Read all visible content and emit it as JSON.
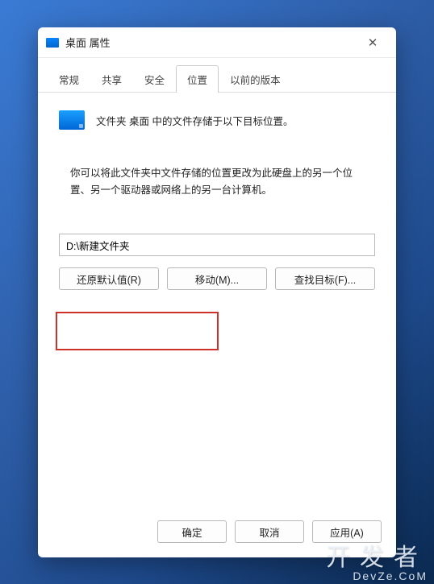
{
  "window": {
    "title": "桌面 属性"
  },
  "tabs": {
    "general": "常规",
    "sharing": "共享",
    "security": "安全",
    "location": "位置",
    "previous": "以前的版本",
    "active": "location"
  },
  "location": {
    "desc": "文件夹 桌面 中的文件存储于以下目标位置。",
    "explain": "你可以将此文件夹中文件存储的位置更改为此硬盘上的另一个位置、另一个驱动器或网络上的另一台计算机。",
    "path": "D:\\新建文件夹",
    "restore_label": "还原默认值(R)",
    "move_label": "移动(M)...",
    "find_label": "查找目标(F)..."
  },
  "footer": {
    "ok": "确定",
    "cancel": "取消",
    "apply": "应用(A)"
  },
  "watermark": {
    "main": "开发者",
    "sub": "DevZe.CoM"
  }
}
